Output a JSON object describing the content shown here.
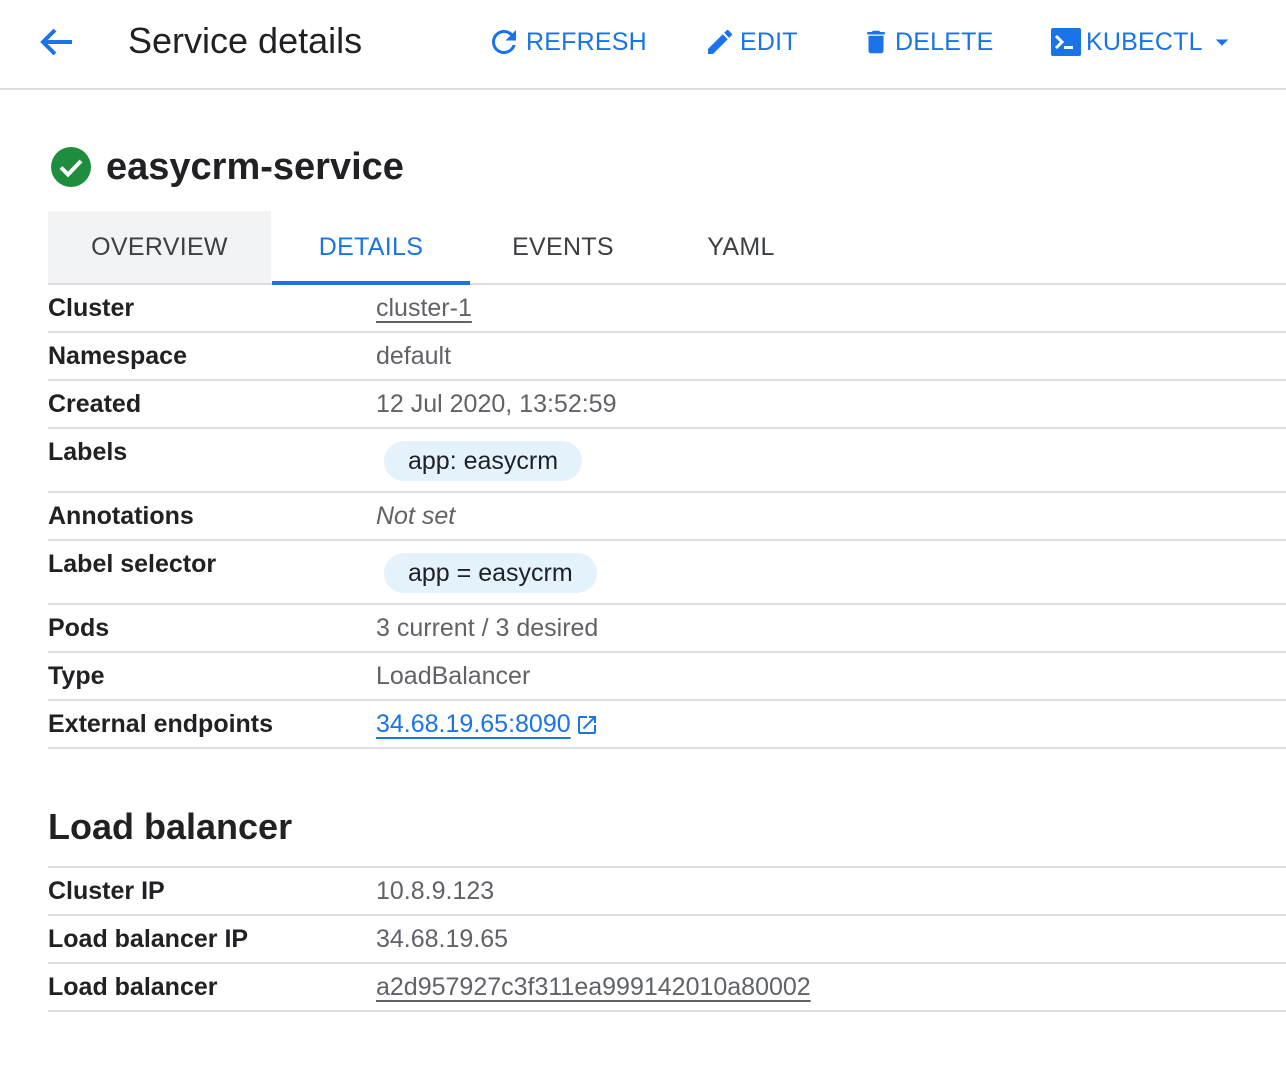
{
  "header": {
    "title": "Service details",
    "actions": {
      "refresh": "REFRESH",
      "edit": "EDIT",
      "delete": "DELETE",
      "kubectl": "KUBECTL"
    }
  },
  "resource": {
    "name": "easycrm-service",
    "status_icon": "check-circle-icon",
    "status_color": "#1e8e3e"
  },
  "tabs": [
    {
      "label": "OVERVIEW",
      "active": false
    },
    {
      "label": "DETAILS",
      "active": true
    },
    {
      "label": "EVENTS",
      "active": false
    },
    {
      "label": "YAML",
      "active": false
    }
  ],
  "details": {
    "cluster": {
      "label": "Cluster",
      "value": "cluster-1"
    },
    "namespace": {
      "label": "Namespace",
      "value": "default"
    },
    "created": {
      "label": "Created",
      "value": "12 Jul 2020, 13:52:59"
    },
    "labels": {
      "label": "Labels",
      "value": "app: easycrm"
    },
    "annotations": {
      "label": "Annotations",
      "value": "Not set"
    },
    "label_selector": {
      "label": "Label selector",
      "value": "app = easycrm"
    },
    "pods": {
      "label": "Pods",
      "value": "3 current / 3 desired"
    },
    "type": {
      "label": "Type",
      "value": "LoadBalancer"
    },
    "external_endpoints": {
      "label": "External endpoints",
      "value": "34.68.19.65:8090"
    }
  },
  "load_balancer": {
    "title": "Load balancer",
    "cluster_ip": {
      "label": "Cluster IP",
      "value": "10.8.9.123"
    },
    "lb_ip": {
      "label": "Load balancer IP",
      "value": "34.68.19.65"
    },
    "lb_name": {
      "label": "Load balancer",
      "value": "a2d957927c3f311ea999142010a80002"
    }
  },
  "colors": {
    "accent": "#1a73e8",
    "success": "#1e8e3e",
    "chip": "#e4f3fb",
    "divider": "#dadce0"
  }
}
